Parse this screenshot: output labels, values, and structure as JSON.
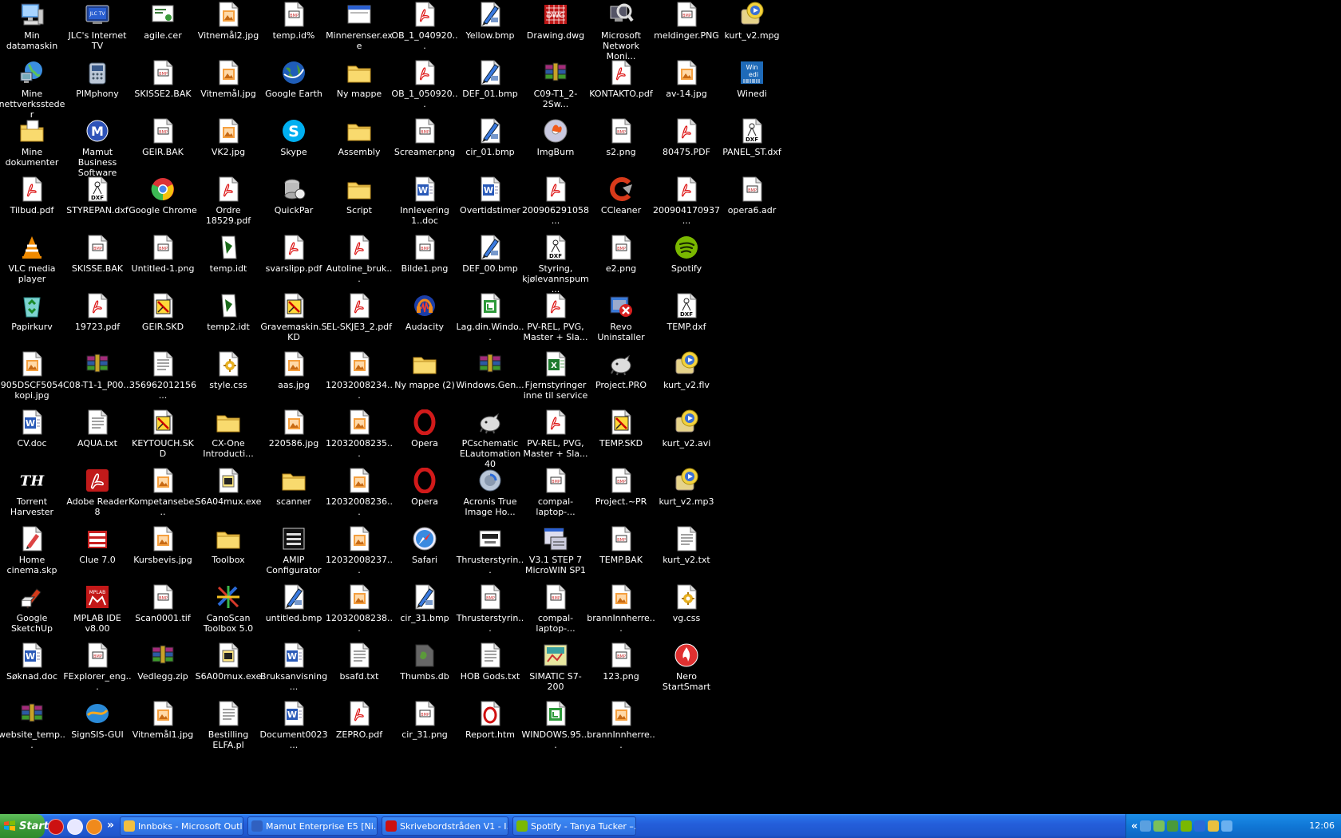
{
  "desktop": {
    "columns": [
      [
        {
          "label": "Min datamaskin",
          "icon": "my-computer-icon",
          "kind": "computer"
        },
        {
          "label": "Mine\nnettverkssteder",
          "icon": "network-places-icon",
          "kind": "network"
        },
        {
          "label": "Mine dokumenter",
          "icon": "my-documents-icon",
          "kind": "folderdoc"
        },
        {
          "label": "Tilbud.pdf",
          "icon": "pdf-file-icon",
          "kind": "pdf"
        },
        {
          "label": "VLC media player",
          "icon": "vlc-icon",
          "kind": "vlc"
        },
        {
          "label": "Papirkurv",
          "icon": "recycle-bin-icon",
          "kind": "recycle"
        },
        {
          "label": "905DSCF5054\nkopi.jpg",
          "icon": "jpg-file-icon",
          "kind": "img"
        },
        {
          "label": "CV.doc",
          "icon": "word-doc-icon",
          "kind": "word"
        },
        {
          "label": "Torrent\nHarvester",
          "icon": "torrent-harvester-icon",
          "kind": "th"
        },
        {
          "label": "Home cinema.skp",
          "icon": "sketchup-file-icon",
          "kind": "skp"
        },
        {
          "label": "Google SketchUp",
          "icon": "google-sketchup-icon",
          "kind": "sketchup"
        },
        {
          "label": "Søknad.doc",
          "icon": "word-doc-icon",
          "kind": "word"
        },
        {
          "label": "website_temp...",
          "icon": "winrar-archive-icon",
          "kind": "rar"
        }
      ],
      [
        {
          "label": "JLC's Internet TV",
          "icon": "internet-tv-icon",
          "kind": "tv"
        },
        {
          "label": "PIMphony",
          "icon": "pimphony-phone-icon",
          "kind": "phone"
        },
        {
          "label": "Mamut Business\nSoftware",
          "icon": "mamut-icon",
          "kind": "mamut"
        },
        {
          "label": "STYREPAN.dxf",
          "icon": "dxf-file-icon",
          "kind": "dxf"
        },
        {
          "label": "SKISSE.BAK",
          "icon": "generic-image-file-icon",
          "kind": "imgdoc"
        },
        {
          "label": "19723.pdf",
          "icon": "pdf-file-icon",
          "kind": "pdf"
        },
        {
          "label": "C08-T1-1_P00...",
          "icon": "winrar-archive-icon",
          "kind": "rar"
        },
        {
          "label": "AQUA.txt",
          "icon": "text-file-icon",
          "kind": "txt"
        },
        {
          "label": "Adobe Reader 8",
          "icon": "adobe-reader-icon",
          "kind": "adobe"
        },
        {
          "label": "Clue 7.0",
          "icon": "clue-icon",
          "kind": "clue"
        },
        {
          "label": "MPLAB IDE v8.00",
          "icon": "mplab-icon",
          "kind": "mplab"
        },
        {
          "label": "FExplorer_eng...",
          "icon": "generic-image-file-icon",
          "kind": "imgdoc"
        },
        {
          "label": "SignSIS-GUI",
          "icon": "signsis-icon",
          "kind": "signsis"
        }
      ],
      [
        {
          "label": "agile.cer",
          "icon": "certificate-icon",
          "kind": "cert"
        },
        {
          "label": "SKISSE2.BAK",
          "icon": "generic-image-file-icon",
          "kind": "imgdoc"
        },
        {
          "label": "GEIR.BAK",
          "icon": "generic-image-file-icon",
          "kind": "imgdoc"
        },
        {
          "label": "Google Chrome",
          "icon": "chrome-icon",
          "kind": "chrome"
        },
        {
          "label": "Untitled-1.png",
          "icon": "generic-image-file-icon",
          "kind": "imgdoc"
        },
        {
          "label": "GEIR.SKD",
          "icon": "skd-file-icon",
          "kind": "skd"
        },
        {
          "label": "356962012156...",
          "icon": "text-file-icon",
          "kind": "txt"
        },
        {
          "label": "KEYTOUCH.SKD",
          "icon": "skd-file-icon",
          "kind": "skd"
        },
        {
          "label": "Kompetansebe...",
          "icon": "jpg-file-icon",
          "kind": "img"
        },
        {
          "label": "Kursbevis.jpg",
          "icon": "jpg-file-icon",
          "kind": "img"
        },
        {
          "label": "Scan0001.tif",
          "icon": "generic-image-file-icon",
          "kind": "imgdoc"
        },
        {
          "label": "Vedlegg.zip",
          "icon": "winrar-archive-icon",
          "kind": "rar"
        },
        {
          "label": "Vitnemål1.jpg",
          "icon": "jpg-file-icon",
          "kind": "img"
        }
      ],
      [
        {
          "label": "Vitnemål2.jpg",
          "icon": "jpg-file-icon",
          "kind": "img"
        },
        {
          "label": "Vitnemål.jpg",
          "icon": "jpg-file-icon",
          "kind": "img"
        },
        {
          "label": "VK2.jpg",
          "icon": "jpg-file-icon",
          "kind": "img"
        },
        {
          "label": "Ordre 18529.pdf",
          "icon": "pdf-file-icon",
          "kind": "pdf"
        },
        {
          "label": "temp.idt",
          "icon": "idt-file-icon",
          "kind": "idt"
        },
        {
          "label": "temp2.idt",
          "icon": "idt-file-icon",
          "kind": "idt"
        },
        {
          "label": "style.css",
          "icon": "css-file-icon",
          "kind": "css"
        },
        {
          "label": "CX-One\nIntroducti...",
          "icon": "folder-icon",
          "kind": "folder"
        },
        {
          "label": "S6A04mux.exe",
          "icon": "exe-file-icon",
          "kind": "exe"
        },
        {
          "label": "Toolbox",
          "icon": "folder-icon",
          "kind": "folder"
        },
        {
          "label": "CanoScan\nToolbox 5.0",
          "icon": "canoscan-icon",
          "kind": "canoscan"
        },
        {
          "label": "S6A00mux.exe",
          "icon": "exe-file-icon",
          "kind": "exe"
        },
        {
          "label": "Bestilling ELFA.pl",
          "icon": "text-file-icon",
          "kind": "txt"
        }
      ],
      [
        {
          "label": "temp.id%",
          "icon": "generic-image-file-icon",
          "kind": "imgdoc"
        },
        {
          "label": "Google Earth",
          "icon": "google-earth-icon",
          "kind": "earth"
        },
        {
          "label": "Skype",
          "icon": "skype-icon",
          "kind": "skype"
        },
        {
          "label": "QuickPar",
          "icon": "quickpar-icon",
          "kind": "quickpar"
        },
        {
          "label": "svarslipp.pdf",
          "icon": "pdf-file-icon",
          "kind": "pdf"
        },
        {
          "label": "Gravemaskin.SKD",
          "icon": "skd-file-icon",
          "kind": "skd"
        },
        {
          "label": "aas.jpg",
          "icon": "jpg-file-icon",
          "kind": "img"
        },
        {
          "label": "220586.jpg",
          "icon": "jpg-file-icon",
          "kind": "img"
        },
        {
          "label": "scanner",
          "icon": "folder-icon",
          "kind": "folder"
        },
        {
          "label": "AMIP\nConfigurator",
          "icon": "amip-icon",
          "kind": "amip"
        },
        {
          "label": "untitled.bmp",
          "icon": "bmp-file-icon",
          "kind": "bmp"
        },
        {
          "label": "Bruksanvisning...",
          "icon": "word-doc-icon",
          "kind": "word"
        },
        {
          "label": "Document0023...",
          "icon": "word-doc-icon",
          "kind": "word"
        }
      ],
      [
        {
          "label": "Minnerenser.exe",
          "icon": "window-exe-icon",
          "kind": "window"
        },
        {
          "label": "Ny mappe",
          "icon": "folder-icon",
          "kind": "folder"
        },
        {
          "label": "Assembly",
          "icon": "folder-icon",
          "kind": "folder"
        },
        {
          "label": "Script",
          "icon": "folder-icon",
          "kind": "folder"
        },
        {
          "label": "Autoline_bruk...",
          "icon": "pdf-file-icon",
          "kind": "pdf"
        },
        {
          "label": "EL-SKJE3_2.pdf",
          "icon": "pdf-file-icon",
          "kind": "pdf"
        },
        {
          "label": "12032008234...",
          "icon": "jpg-file-icon",
          "kind": "img"
        },
        {
          "label": "12032008235...",
          "icon": "jpg-file-icon",
          "kind": "img"
        },
        {
          "label": "12032008236...",
          "icon": "jpg-file-icon",
          "kind": "img"
        },
        {
          "label": "12032008237...",
          "icon": "jpg-file-icon",
          "kind": "img"
        },
        {
          "label": "12032008238...",
          "icon": "jpg-file-icon",
          "kind": "img"
        },
        {
          "label": "bsafd.txt",
          "icon": "text-file-icon",
          "kind": "txt"
        },
        {
          "label": "ZEPRO.pdf",
          "icon": "pdf-file-icon",
          "kind": "pdf"
        }
      ],
      [
        {
          "label": "OB_1_040920...",
          "icon": "pdf-file-icon",
          "kind": "pdf"
        },
        {
          "label": "OB_1_050920...",
          "icon": "pdf-file-icon",
          "kind": "pdf"
        },
        {
          "label": "Screamer.png",
          "icon": "generic-image-file-icon",
          "kind": "imgdoc"
        },
        {
          "label": "Innlevering\n1..doc",
          "icon": "word-doc-icon",
          "kind": "word"
        },
        {
          "label": "Bilde1.png",
          "icon": "generic-image-file-icon",
          "kind": "imgdoc"
        },
        {
          "label": "Audacity",
          "icon": "audacity-icon",
          "kind": "audacity"
        },
        {
          "label": "Ny mappe (2)",
          "icon": "folder-icon",
          "kind": "folder"
        },
        {
          "label": "Opera",
          "icon": "opera-icon",
          "kind": "opera"
        },
        {
          "label": "Opera",
          "icon": "opera-icon",
          "kind": "opera"
        },
        {
          "label": "Safari",
          "icon": "safari-icon",
          "kind": "safari"
        },
        {
          "label": "cir_31.bmp",
          "icon": "bmp-file-icon",
          "kind": "bmp"
        },
        {
          "label": "Thumbs.db",
          "icon": "thumbs-db-icon",
          "kind": "thumbs"
        },
        {
          "label": "cir_31.png",
          "icon": "generic-image-file-icon",
          "kind": "imgdoc"
        }
      ],
      [
        {
          "label": "Yellow.bmp",
          "icon": "bmp-file-icon",
          "kind": "bmp"
        },
        {
          "label": "DEF_01.bmp",
          "icon": "bmp-file-icon",
          "kind": "bmp"
        },
        {
          "label": "cir_01.bmp",
          "icon": "bmp-file-icon",
          "kind": "bmp"
        },
        {
          "label": "Overtidstimer",
          "icon": "word-doc-icon",
          "kind": "word"
        },
        {
          "label": "DEF_00.bmp",
          "icon": "bmp-file-icon",
          "kind": "bmp"
        },
        {
          "label": "Lag.din.Windo...",
          "icon": "green-doc-icon",
          "kind": "greendoc"
        },
        {
          "label": "Windows.Gen...",
          "icon": "winrar-archive-icon",
          "kind": "rar"
        },
        {
          "label": "PCschematic\nELautomation 40",
          "icon": "pcschematic-icon",
          "kind": "pcs"
        },
        {
          "label": "Acronis True\nImage Ho...",
          "icon": "acronis-icon",
          "kind": "acronis"
        },
        {
          "label": "Thrusterstyrin...",
          "icon": "thruster-icon",
          "kind": "thruster"
        },
        {
          "label": "Thrusterstyrin...",
          "icon": "generic-image-file-icon",
          "kind": "imgdoc"
        },
        {
          "label": "HOB Gods.txt",
          "icon": "text-file-icon",
          "kind": "txt"
        },
        {
          "label": "Report.htm",
          "icon": "opera-html-icon",
          "kind": "operadoc"
        }
      ],
      [
        {
          "label": "Drawing.dwg",
          "icon": "dwg-file-icon",
          "kind": "dwg"
        },
        {
          "label": "C09-T1_2-2Sw...",
          "icon": "winrar-archive-icon",
          "kind": "rar"
        },
        {
          "label": "ImgBurn",
          "icon": "imgburn-icon",
          "kind": "imgburn"
        },
        {
          "label": "200906291058...",
          "icon": "pdf-file-icon",
          "kind": "pdf"
        },
        {
          "label": "Styring,\nkjølevannspum...",
          "icon": "dxf-file-icon",
          "kind": "dxf"
        },
        {
          "label": "PV-REL, PVG,\nMaster + Sla...",
          "icon": "pdf-file-icon",
          "kind": "pdf"
        },
        {
          "label": "Fjernstyringer\ninne til service",
          "icon": "excel-file-icon",
          "kind": "excel"
        },
        {
          "label": "PV-REL, PVG,\nMaster + Sla...",
          "icon": "pdf-file-icon",
          "kind": "pdf"
        },
        {
          "label": "compal-laptop-...",
          "icon": "generic-image-file-icon",
          "kind": "imgdoc"
        },
        {
          "label": "V3.1 STEP 7\nMicroWIN SP1",
          "icon": "step7-icon",
          "kind": "step7"
        },
        {
          "label": "compal-laptop-...",
          "icon": "generic-image-file-icon",
          "kind": "imgdoc"
        },
        {
          "label": "SIMATIC S7-200",
          "icon": "simatic-icon",
          "kind": "simatic"
        },
        {
          "label": "WINDOWS.95....",
          "icon": "green-doc-icon",
          "kind": "greendoc"
        }
      ],
      [
        {
          "label": "Microsoft\nNetwork Moni...",
          "icon": "network-monitor-icon",
          "kind": "netmon"
        },
        {
          "label": "KONTAKTO.pdf",
          "icon": "pdf-file-icon",
          "kind": "pdf"
        },
        {
          "label": "s2.png",
          "icon": "generic-image-file-icon",
          "kind": "imgdoc"
        },
        {
          "label": "CCleaner",
          "icon": "ccleaner-icon",
          "kind": "ccleaner"
        },
        {
          "label": "e2.png",
          "icon": "generic-image-file-icon",
          "kind": "imgdoc"
        },
        {
          "label": "Revo Uninstaller",
          "icon": "revo-uninstaller-icon",
          "kind": "revo"
        },
        {
          "label": "Project.PRO",
          "icon": "pcschematic-file-icon",
          "kind": "pcs"
        },
        {
          "label": "TEMP.SKD",
          "icon": "skd-file-icon",
          "kind": "skd"
        },
        {
          "label": "Project.~PR",
          "icon": "generic-image-file-icon",
          "kind": "imgdoc"
        },
        {
          "label": "TEMP.BAK",
          "icon": "generic-image-file-icon",
          "kind": "imgdoc"
        },
        {
          "label": "brannInnherre...",
          "icon": "jpg-file-icon",
          "kind": "img"
        },
        {
          "label": "123.png",
          "icon": "generic-image-file-icon",
          "kind": "imgdoc"
        },
        {
          "label": "brannInnherre...",
          "icon": "jpg-file-icon",
          "kind": "img"
        }
      ],
      [
        {
          "label": "meldinger.PNG",
          "icon": "generic-image-file-icon",
          "kind": "imgdoc"
        },
        {
          "label": "av-14.jpg",
          "icon": "jpg-file-icon",
          "kind": "img"
        },
        {
          "label": "80475.PDF",
          "icon": "pdf-file-icon",
          "kind": "pdf"
        },
        {
          "label": "200904170937...",
          "icon": "pdf-file-icon",
          "kind": "pdf"
        },
        {
          "label": "Spotify",
          "icon": "spotify-icon",
          "kind": "spotify"
        },
        {
          "label": "TEMP.dxf",
          "icon": "dxf-file-icon",
          "kind": "dxf"
        },
        {
          "label": "kurt_v2.flv",
          "icon": "media-file-icon",
          "kind": "media"
        },
        {
          "label": "kurt_v2.avi",
          "icon": "media-file-icon",
          "kind": "media"
        },
        {
          "label": "kurt_v2.mp3",
          "icon": "media-file-icon",
          "kind": "media"
        },
        {
          "label": "kurt_v2.txt",
          "icon": "text-file-icon",
          "kind": "txt"
        },
        {
          "label": "vg.css",
          "icon": "css-file-icon",
          "kind": "css"
        },
        {
          "label": "Nero StartSmart",
          "icon": "nero-icon",
          "kind": "nero"
        }
      ],
      [
        {
          "label": "kurt_v2.mpg",
          "icon": "media-file-icon",
          "kind": "media"
        },
        {
          "label": "Winedi",
          "icon": "winedi-icon",
          "kind": "winedi"
        },
        {
          "label": "PANEL_ST.dxf",
          "icon": "dxf-file-icon",
          "kind": "dxf"
        },
        {
          "label": "opera6.adr",
          "icon": "generic-image-file-icon",
          "kind": "imgdoc"
        }
      ]
    ]
  },
  "taskbar": {
    "start_label": "Start",
    "chevron": "»",
    "quick_launch": [
      {
        "icon": "opera-icon",
        "color": "#cc1111"
      },
      {
        "icon": "outlook-icon",
        "color": "#e8e8ff"
      },
      {
        "icon": "firefox-icon",
        "color": "#f08a1c"
      }
    ],
    "buttons": [
      {
        "label": "Innboks - Microsoft Outlook",
        "icon": "outlook-icon",
        "color": "#f2c040"
      },
      {
        "label": "Mamut Enterprise E5  [Ni...",
        "icon": "mamut-icon",
        "color": "#3060c0"
      },
      {
        "label": "Skrivebordstråden V1 - I...",
        "icon": "opera-icon",
        "color": "#cc1111"
      },
      {
        "label": "Spotify - Tanya Tucker –...",
        "icon": "spotify-icon",
        "color": "#7ab800"
      }
    ],
    "tray_icons": [
      "expand-tray-icon",
      "user-icon",
      "network-icon",
      "spotify-tray-icon",
      "info-icon",
      "shield-icon",
      "search-icon",
      "monitor-icon"
    ],
    "tray_expand": "«",
    "clock": "12:06"
  }
}
